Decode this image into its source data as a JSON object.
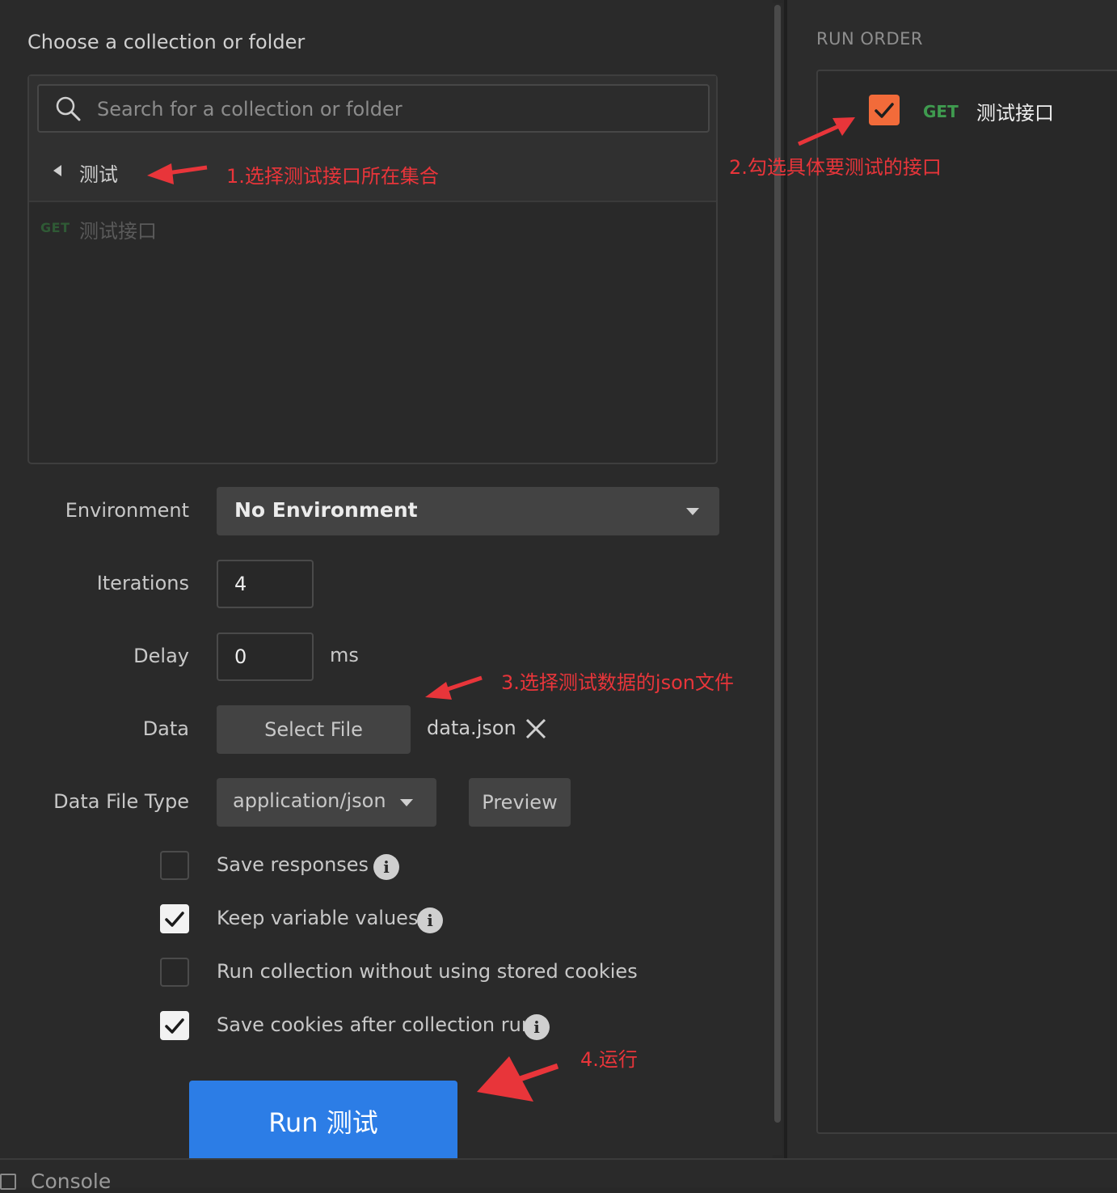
{
  "collection_picker": {
    "title": "Choose a collection or folder",
    "search_placeholder": "Search for a collection or folder",
    "folder_name": "测试",
    "requests": [
      {
        "method": "GET",
        "name": "测试接口"
      }
    ]
  },
  "settings": {
    "environment_label": "Environment",
    "environment_value": "No Environment",
    "iterations_label": "Iterations",
    "iterations_value": "4",
    "delay_label": "Delay",
    "delay_value": "0",
    "delay_unit": "ms",
    "data_label": "Data",
    "select_file_label": "Select File",
    "data_file_name": "data.json",
    "data_file_type_label": "Data File Type",
    "data_file_type_value": "application/json",
    "preview_label": "Preview"
  },
  "options": [
    {
      "label": "Save responses",
      "checked": false,
      "has_info": true
    },
    {
      "label": "Keep variable values",
      "checked": true,
      "has_info": true
    },
    {
      "label": "Run collection without using stored cookies",
      "checked": false,
      "has_info": false
    },
    {
      "label": "Save cookies after collection run",
      "checked": true,
      "has_info": true
    }
  ],
  "run_button_label": "Run 测试",
  "console_label": "Console",
  "run_order": {
    "title": "RUN ORDER",
    "items": [
      {
        "method": "GET",
        "name": "测试接口",
        "checked": true
      }
    ]
  },
  "annotations": {
    "step1": "1.选择测试接口所在集合",
    "step2": "2.勾选具体要测试的接口",
    "step3": "3.选择测试数据的json文件",
    "step4": "4.运行"
  },
  "colors": {
    "background": "#2a2a2a",
    "accent_blue": "#2c7de6",
    "checkbox_orange": "#f26b3a",
    "get_method_green": "#3f9b4f",
    "annotation_red": "#e8353a"
  }
}
